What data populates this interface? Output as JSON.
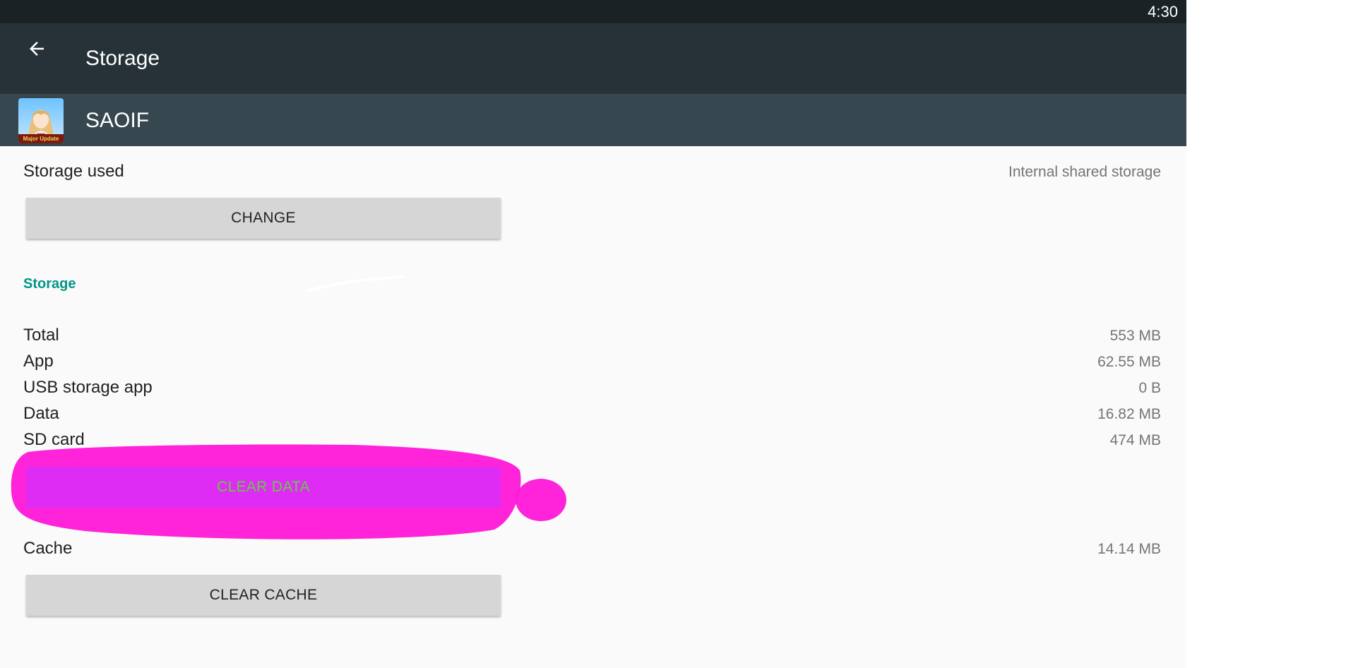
{
  "status_bar": {
    "time": "4:30"
  },
  "app_bar": {
    "back_icon": "arrow-back-icon",
    "title": "Storage"
  },
  "app_header": {
    "icon": "saoif-app-icon",
    "icon_caption": "Major Update",
    "name": "SAOIF"
  },
  "storage_used": {
    "label": "Storage used",
    "location": "Internal shared storage",
    "change_button": "CHANGE"
  },
  "storage_section": {
    "header": "Storage",
    "rows": [
      {
        "label": "Total",
        "value": "553 MB"
      },
      {
        "label": "App",
        "value": "62.55 MB"
      },
      {
        "label": "USB storage app",
        "value": "0 B"
      },
      {
        "label": "Data",
        "value": "16.82 MB"
      },
      {
        "label": "SD card",
        "value": "474 MB"
      }
    ],
    "clear_data_button": "CLEAR DATA"
  },
  "cache": {
    "label": "Cache",
    "value": "14.14 MB",
    "clear_cache_button": "CLEAR CACHE"
  },
  "colors": {
    "status_bar": "#1b2226",
    "app_bar": "#263238",
    "app_header": "#37474f",
    "accent": "#009688",
    "highlight_marker": "#ff1ad9"
  }
}
